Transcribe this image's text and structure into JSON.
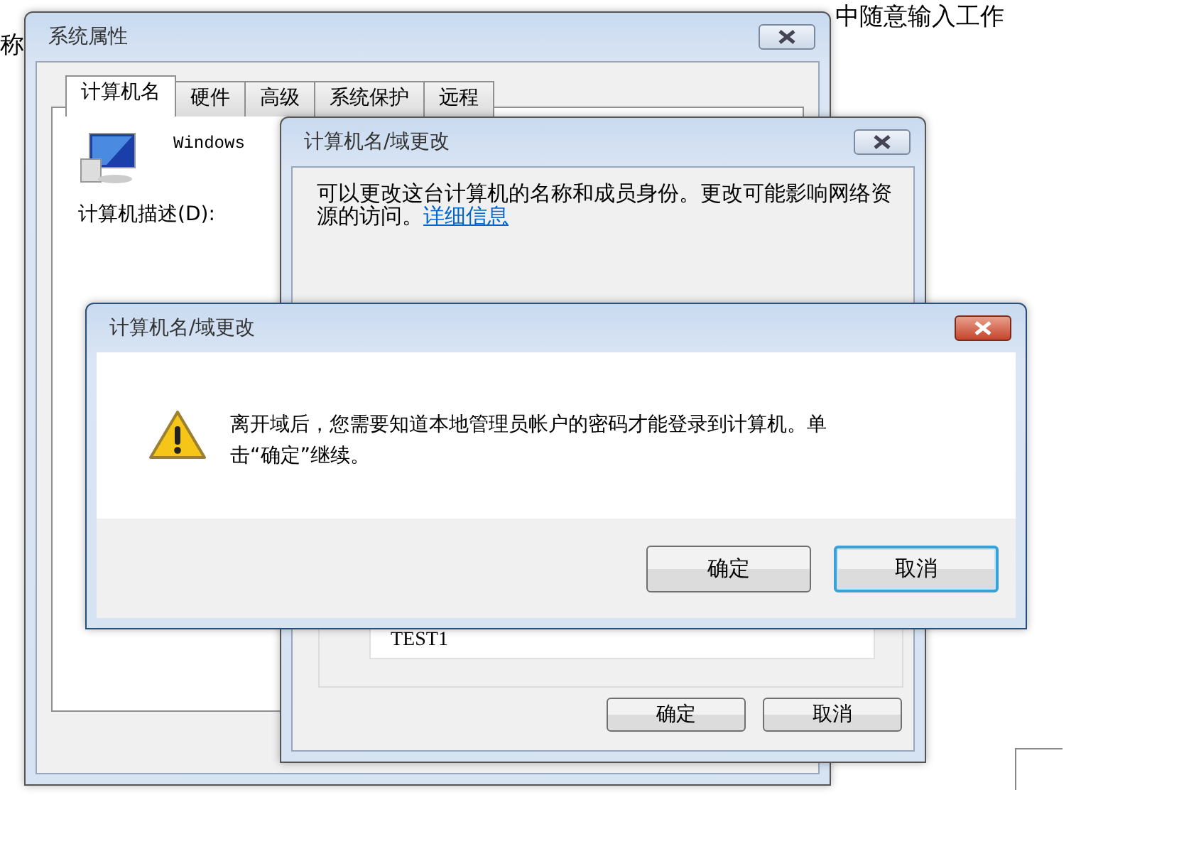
{
  "background_document": {
    "lines": [
      "中随意输入工作",
      "称"
    ]
  },
  "system_properties": {
    "title": "系统属性",
    "tabs": [
      {
        "label": "计算机名",
        "selected": true
      },
      {
        "label": "硬件",
        "selected": false
      },
      {
        "label": "高级",
        "selected": false
      },
      {
        "label": "系统保护",
        "selected": false
      },
      {
        "label": "远程",
        "selected": false
      }
    ],
    "os_label": "Windows",
    "description_label": "计算机描述(D):"
  },
  "change_dialog": {
    "title": "计算机名/域更改",
    "intro": "可以更改这台计算机的名称和成员身份。更改可能影响网络资源的访问。",
    "link": "详细信息",
    "computer_name_value": "TEST1",
    "buttons": [
      "确定",
      "取消"
    ]
  },
  "warning_dialog": {
    "title": "计算机名/域更改",
    "message": "离开域后，您需要知道本地管理员帐户的密码才能登录到计算机。单击“确定”继续。",
    "buttons": [
      {
        "label": "确定",
        "focused": false
      },
      {
        "label": "取消",
        "focused": true
      }
    ]
  }
}
